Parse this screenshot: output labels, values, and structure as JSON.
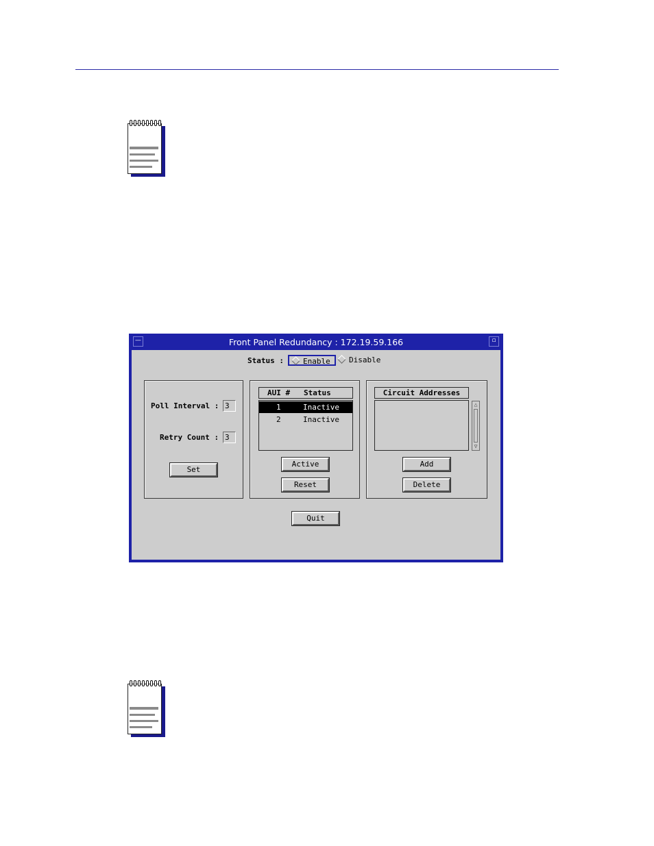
{
  "window": {
    "title": "Front Panel Redundancy : 172.19.59.166",
    "menu_glyph": "—",
    "max_glyph": "▫"
  },
  "status": {
    "label": "Status :",
    "options": [
      "Enable",
      "Disable"
    ],
    "selected": "Enable"
  },
  "poll": {
    "interval_label": "Poll Interval :",
    "interval_value": "3",
    "retry_label": "Retry Count :",
    "retry_value": "3",
    "set_label": "Set"
  },
  "aui": {
    "columns": [
      "AUI #",
      "Status"
    ],
    "rows": [
      {
        "num": "1",
        "status": "Inactive",
        "selected": true
      },
      {
        "num": "2",
        "status": "Inactive",
        "selected": false
      }
    ],
    "active_label": "Active",
    "reset_label": "Reset"
  },
  "circuit": {
    "header": "Circuit Addresses",
    "add_label": "Add",
    "delete_label": "Delete",
    "scroll_up": "△",
    "scroll_down": "▽"
  },
  "quit_label": "Quit",
  "colors": {
    "title_bar": "#1e22a8",
    "window_bg": "#cdcdcd",
    "rule": "#2a2aa6"
  },
  "icons": [
    "notepad-note-icon",
    "notepad-note-icon"
  ]
}
